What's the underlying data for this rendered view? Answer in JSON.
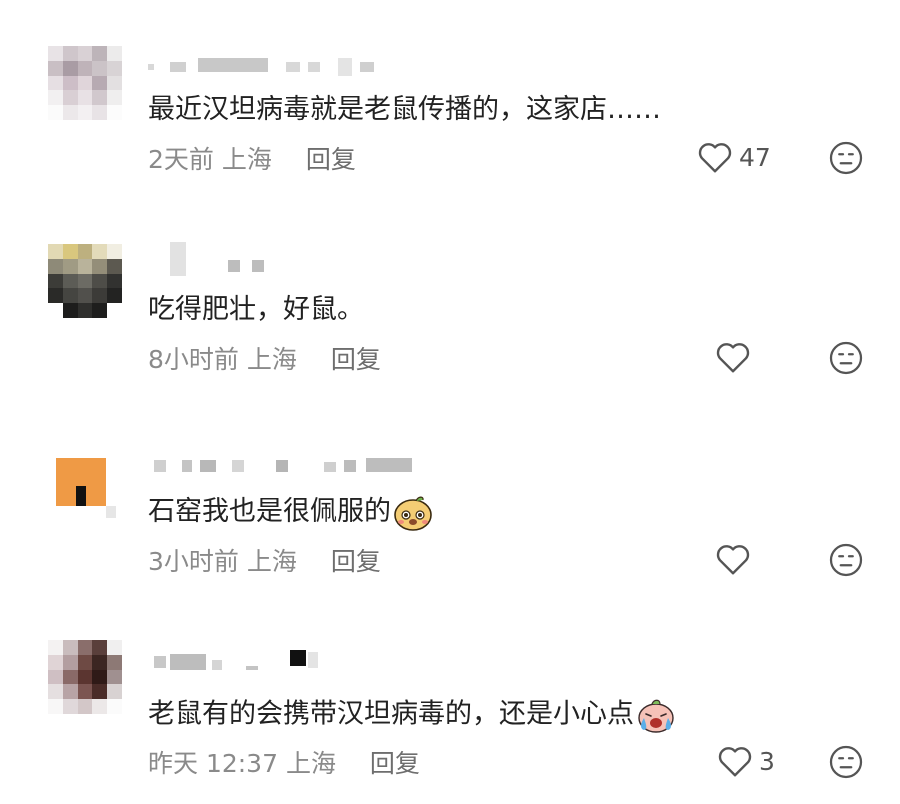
{
  "comments": [
    {
      "text": "最近汉坦病毒就是老鼠传播的，这家店……",
      "time": "2天前",
      "location": "上海",
      "reply": "回复",
      "likes": "47"
    },
    {
      "text": "吃得肥壮，好鼠。",
      "time": "8小时前",
      "location": "上海",
      "reply": "回复",
      "likes": ""
    },
    {
      "text": "石窑我也是很佩服的",
      "time": "3小时前",
      "location": "上海",
      "reply": "回复",
      "likes": ""
    },
    {
      "text": "老鼠有的会携带汉坦病毒的，还是小心点",
      "time": "昨天 12:37",
      "location": "上海",
      "reply": "回复",
      "likes": "3"
    }
  ],
  "icons": {
    "like": "heart-icon",
    "dislike": "dislike-face-icon",
    "emoji_3": "mouse-emoji",
    "emoji_4": "crying-emoji"
  },
  "colors": {
    "text": "#222222",
    "meta": "#8a8a8a",
    "placeholder": "#d8d8d8"
  }
}
